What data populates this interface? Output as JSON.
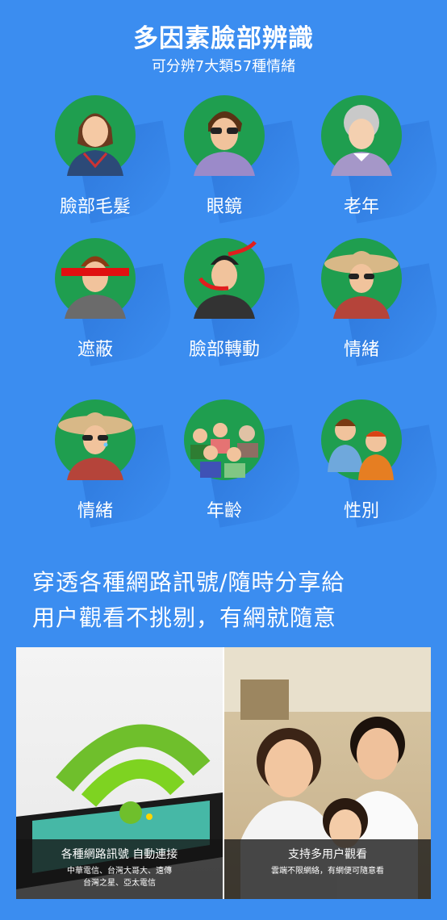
{
  "header": {
    "title": "多因素臉部辨識",
    "subtitle": "可分辨7大類57種情緒"
  },
  "features": [
    {
      "label": "臉部毛髮",
      "icon": "girl-face-icon"
    },
    {
      "label": "眼鏡",
      "icon": "sunglasses-man-icon"
    },
    {
      "label": "老年",
      "icon": "elderly-woman-icon"
    },
    {
      "label": "遮蔽",
      "icon": "masked-eyes-man-icon"
    },
    {
      "label": "臉部轉動",
      "icon": "rotating-head-icon"
    },
    {
      "label": "情緒",
      "icon": "hat-woman-icon"
    },
    {
      "label": "情緒",
      "icon": "hat-woman-crying-icon"
    },
    {
      "label": "年齡",
      "icon": "family-group-icon"
    },
    {
      "label": "性別",
      "icon": "couple-icon"
    }
  ],
  "tagline": {
    "line1": "穿透各種網路訊號/隨時分享給",
    "line2": "用户觀看不挑剔，有網就隨意"
  },
  "photos": {
    "left": {
      "title": "各種網路訊號 自動連接",
      "line1": "中華電信、台灣大哥大、遠傳",
      "line2": "台灣之星、亞太電信"
    },
    "right": {
      "title": "支持多用户觀看",
      "line1": "雲端不限網絡，有網便可隨意看"
    }
  }
}
